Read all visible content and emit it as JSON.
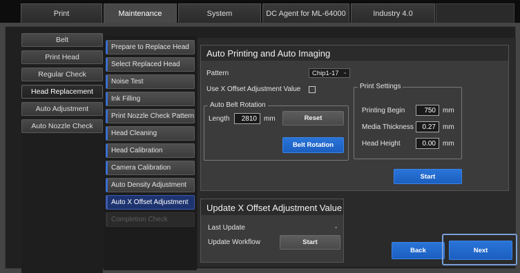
{
  "tabs": [
    "Print",
    "Maintenance",
    "System",
    "DC Agent for ML-64000",
    "Industry 4.0"
  ],
  "active_tab": 1,
  "left_menu": {
    "items": [
      "Belt",
      "Print Head",
      "Regular Check",
      "Head Replacement",
      "Auto Adjustment",
      "Auto Nozzle Check"
    ],
    "active_index": 3
  },
  "steps": {
    "items": [
      "Prepare to Replace Head",
      "Select Replaced Head",
      "Noise Test",
      "Ink Filling",
      "Print Nozzle Check Pattern",
      "Head Cleaning",
      "Head Calibration",
      "Camera Calibration",
      "Auto Density Adjustment",
      "Auto X Offset Adjustment",
      "Completion Check"
    ],
    "active_index": 9,
    "disabled_index": 10
  },
  "auto_printing": {
    "title": "Auto Printing and Auto Imaging",
    "pattern_label": "Pattern",
    "pattern_value": "Chip1-17",
    "use_offset_label": "Use X Offset Adjustment Value",
    "use_offset_checked": false,
    "belt_rotation": {
      "legend": "Auto Belt Rotation",
      "length_label": "Length",
      "length_value": "2810",
      "length_unit": "mm",
      "reset_label": "Reset",
      "belt_rotation_label": "Belt Rotation"
    },
    "print_settings": {
      "legend": "Print Settings",
      "printing_begin_label": "Printing Begin",
      "printing_begin_value": "750",
      "media_thickness_label": "Media Thickness",
      "media_thickness_value": "0.27",
      "head_height_label": "Head Height",
      "head_height_value": "0.00",
      "unit": "mm"
    },
    "start_label": "Start"
  },
  "update_offset": {
    "title": "Update X Offset Adjustment Value",
    "last_update_label": "Last Update",
    "last_update_value": "-",
    "workflow_label": "Update Workflow",
    "start_label": "Start"
  },
  "footer": {
    "back_label": "Back",
    "next_label": "Next"
  },
  "colors": {
    "accent_blue": "#1b5fc0",
    "active_step": "#1e3470",
    "highlight_border": "#7aa0d8"
  }
}
